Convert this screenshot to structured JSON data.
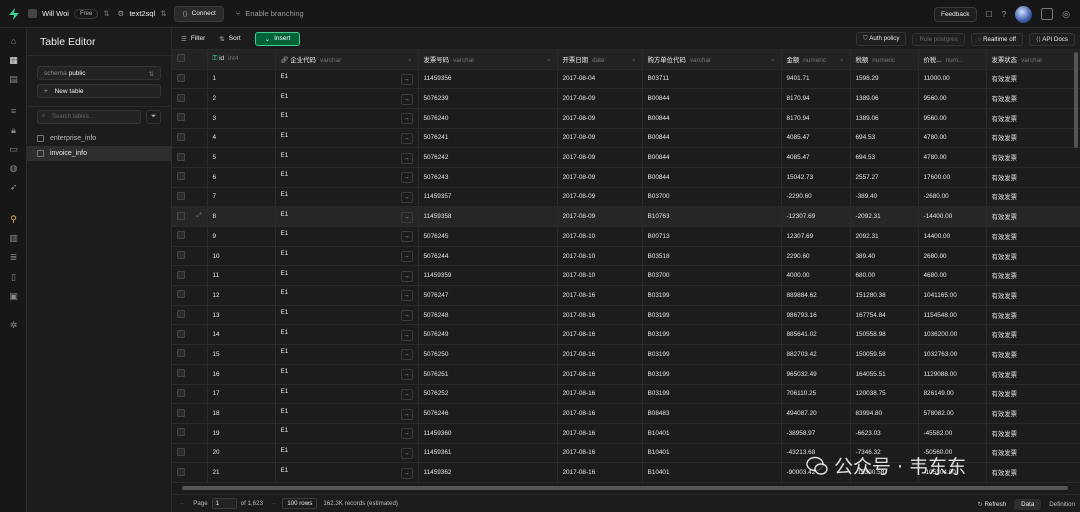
{
  "topbar": {
    "org": "Will Woi",
    "plan": "Free",
    "project": "text2sql",
    "connect": "Connect",
    "branching": "Enable branching",
    "feedback": "Feedback"
  },
  "editor": {
    "title": "Table Editor",
    "schema_prefix": "schema",
    "schema": "public",
    "new_table": "New table",
    "search_placeholder": "Search tables...",
    "tables": [
      "enterprise_info",
      "invoice_info"
    ]
  },
  "toolbar": {
    "filter": "Filter",
    "sort": "Sort",
    "insert": "Insert",
    "auth_policy": "Auth policy",
    "role": "Role postgres",
    "realtime": "Realtime off",
    "api_docs": "API Docs"
  },
  "columns": [
    {
      "name": "id",
      "type": "int4"
    },
    {
      "name": "企业代码",
      "type": "varchar"
    },
    {
      "name": "发票号码",
      "type": "varchar"
    },
    {
      "name": "开票日期",
      "type": "date"
    },
    {
      "name": "购方单位代码",
      "type": "varchar"
    },
    {
      "name": "金额",
      "type": "numeric"
    },
    {
      "name": "税额",
      "type": "numeric"
    },
    {
      "name": "价税...",
      "type": "num..."
    },
    {
      "name": "发票状态",
      "type": "varchar"
    }
  ],
  "rows": [
    [
      "1",
      "E1",
      "11459356",
      "2017-08-04",
      "B03711",
      "9401.71",
      "1598.29",
      "11000.00",
      "有效发票"
    ],
    [
      "2",
      "E1",
      "5076239",
      "2017-08-09",
      "B00844",
      "8170.94",
      "1389.06",
      "9560.00",
      "有效发票"
    ],
    [
      "3",
      "E1",
      "5076240",
      "2017-08-09",
      "B00844",
      "8170.94",
      "1389.06",
      "9560.00",
      "有效发票"
    ],
    [
      "4",
      "E1",
      "5076241",
      "2017-08-09",
      "B00844",
      "4085.47",
      "694.53",
      "4780.00",
      "有效发票"
    ],
    [
      "5",
      "E1",
      "5076242",
      "2017-08-09",
      "B00844",
      "4085.47",
      "694.53",
      "4780.00",
      "有效发票"
    ],
    [
      "6",
      "E1",
      "5076243",
      "2017-08-09",
      "B00844",
      "15042.73",
      "2557.27",
      "17600.00",
      "有效发票"
    ],
    [
      "7",
      "E1",
      "11459357",
      "2017-08-09",
      "B03700",
      "-2290.60",
      "-389.40",
      "-2680.00",
      "有效发票"
    ],
    [
      "8",
      "E1",
      "11459358",
      "2017-08-09",
      "B10763",
      "-12307.69",
      "-2092.31",
      "-14400.00",
      "有效发票"
    ],
    [
      "9",
      "E1",
      "5076245",
      "2017-08-10",
      "B00713",
      "12307.69",
      "2092.31",
      "14400.00",
      "有效发票"
    ],
    [
      "10",
      "E1",
      "5076244",
      "2017-08-10",
      "B03518",
      "2290.60",
      "389.40",
      "2680.00",
      "有效发票"
    ],
    [
      "11",
      "E1",
      "11459359",
      "2017-08-10",
      "B03700",
      "4000.00",
      "680.00",
      "4680.00",
      "有效发票"
    ],
    [
      "12",
      "E1",
      "5076247",
      "2017-08-16",
      "B03199",
      "889884.62",
      "151280.38",
      "1041165.00",
      "有效发票"
    ],
    [
      "13",
      "E1",
      "5076248",
      "2017-08-16",
      "B03199",
      "986793.16",
      "167754.84",
      "1154548.00",
      "有效发票"
    ],
    [
      "14",
      "E1",
      "5076249",
      "2017-08-16",
      "B03199",
      "885641.02",
      "150558.98",
      "1036200.00",
      "有效发票"
    ],
    [
      "15",
      "E1",
      "5076250",
      "2017-08-16",
      "B03199",
      "882703.42",
      "150059.58",
      "1032763.00",
      "有效发票"
    ],
    [
      "16",
      "E1",
      "5076251",
      "2017-08-16",
      "B03199",
      "965032.49",
      "164055.51",
      "1129088.00",
      "有效发票"
    ],
    [
      "17",
      "E1",
      "5076252",
      "2017-08-16",
      "B03199",
      "706110.25",
      "120038.75",
      "826149.00",
      "有效发票"
    ],
    [
      "18",
      "E1",
      "5076246",
      "2017-08-16",
      "B08483",
      "494087.20",
      "83994.80",
      "578082.00",
      "有效发票"
    ],
    [
      "19",
      "E1",
      "11459360",
      "2017-08-16",
      "B10401",
      "-38958.97",
      "-6623.03",
      "-45582.00",
      "有效发票"
    ],
    [
      "20",
      "E1",
      "11459361",
      "2017-08-16",
      "B10401",
      "-43213.68",
      "-7346.32",
      "-50560.00",
      "有效发票"
    ],
    [
      "21",
      "E1",
      "11459362",
      "2017-08-16",
      "B10401",
      "-90003.42",
      "-15300.58",
      "-105304.00",
      "有效发票"
    ]
  ],
  "footer": {
    "page_label": "Page",
    "page": "1",
    "of_pages": "of 1,623",
    "rows_per_page": "100 rows",
    "records": "162.3K records (estimated)",
    "refresh": "Refresh",
    "data_tab": "Data",
    "definition_tab": "Definition"
  },
  "watermark": "公众号 · 韦东东",
  "colors": {
    "accent": "#3ecf8e",
    "insert_bg": "#006239",
    "bg": "#1c1c1c"
  }
}
